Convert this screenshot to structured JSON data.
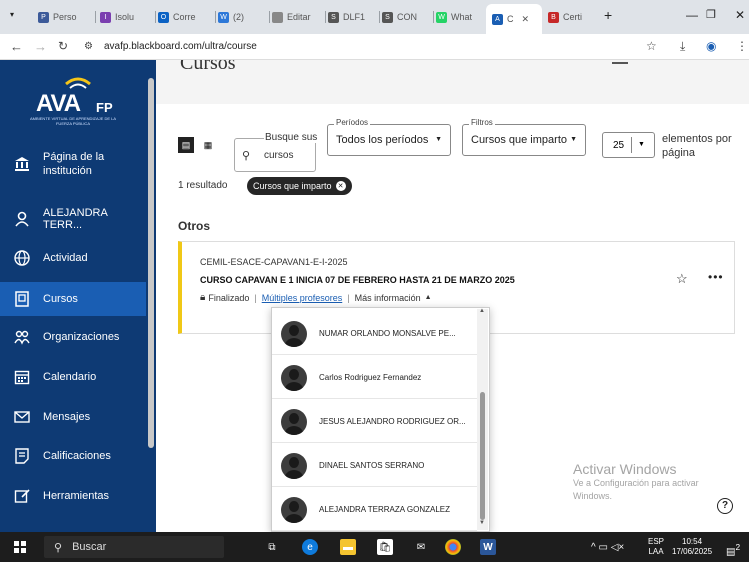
{
  "browser": {
    "tabs": [
      {
        "label": "Perso",
        "color": "#3c5a99",
        "glyph": "P"
      },
      {
        "label": "Isolu",
        "color": "#7b3fb0",
        "glyph": "I"
      },
      {
        "label": "Corre",
        "color": "#0b62c4",
        "glyph": "O"
      },
      {
        "label": "(2)",
        "color": "#2d78d8",
        "glyph": "W"
      },
      {
        "label": "Editar",
        "color": "#888888",
        "glyph": ""
      },
      {
        "label": "DLF1",
        "color": "#555555",
        "glyph": "S"
      },
      {
        "label": "CON",
        "color": "#555555",
        "glyph": "S"
      },
      {
        "label": "What",
        "color": "#25d366",
        "glyph": "W"
      },
      {
        "label": "C",
        "color": "#1a5eb3",
        "glyph": "A"
      },
      {
        "label": "Certi",
        "color": "#c62828",
        "glyph": "B"
      }
    ],
    "new_tab": "+",
    "url": "avafp.blackboard.com/ultra/course"
  },
  "sidebar": {
    "logo_main": "AVA",
    "logo_suffix": "FP",
    "logo_sub": "AMBIENTE VIRTUAL DE APRENDIZAJE DE LA FUERZA PÚBLICA",
    "items": [
      {
        "label": "Página de la institución",
        "icon": "institution-icon"
      },
      {
        "label": "ALEJANDRA TERR...",
        "icon": "user-icon"
      },
      {
        "label": "Actividad",
        "icon": "globe-icon"
      },
      {
        "label": "Cursos",
        "icon": "courses-icon",
        "active": true
      },
      {
        "label": "Organizaciones",
        "icon": "organizations-icon"
      },
      {
        "label": "Calendario",
        "icon": "calendar-icon"
      },
      {
        "label": "Mensajes",
        "icon": "mail-icon"
      },
      {
        "label": "Calificaciones",
        "icon": "grades-icon"
      },
      {
        "label": "Herramientas",
        "icon": "tools-icon"
      }
    ]
  },
  "main": {
    "page_title": "Cursos",
    "search_label": "Busque sus",
    "search_placeholder": "cursos",
    "periods": {
      "legend": "Períodos",
      "value": "Todos los períodos"
    },
    "filters": {
      "legend": "Filtros",
      "value": "Cursos que imparto"
    },
    "page_size": "25",
    "per_page_label": "elementos por página",
    "result_count": "1 resultado",
    "filter_chip": "Cursos que imparto",
    "section_title": "Otros",
    "course": {
      "id": "CEMIL-ESACE-CAPAVAN1-E-I-2025",
      "title": "CURSO CAPAVAN E 1 INICIA 07 DE FEBRERO HASTA 21 DE MARZO 2025",
      "status": "Finalizado",
      "instructors_link": "Múltiples profesores",
      "more_info": "Más información"
    },
    "instructors": [
      "NUMAR ORLANDO MONSALVE PE...",
      "Carlos Rodriguez Fernandez",
      "JESUS ALEJANDRO RODRIGUEZ OR...",
      "DINAEL SANTOS SERRANO",
      "ALEJANDRA TERRAZA GONZALEZ"
    ]
  },
  "watermark": {
    "title": "Activar Windows",
    "subtitle": "Ve a Configuración para activar Windows."
  },
  "taskbar": {
    "search": "Buscar",
    "lang_top": "ESP",
    "lang_bottom": "LAA",
    "time": "10:54",
    "date": "17/06/2025",
    "notif_count": "2"
  }
}
